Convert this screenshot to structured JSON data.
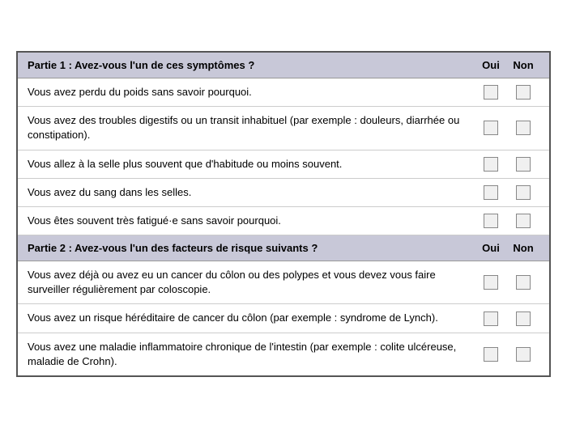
{
  "sections": [
    {
      "id": "partie1",
      "title": "Partie 1 : Avez-vous l'un de ces symptômes ?",
      "oui_label": "Oui",
      "non_label": "Non",
      "questions": [
        {
          "id": "q1",
          "text": "Vous avez perdu du poids sans savoir pourquoi."
        },
        {
          "id": "q2",
          "text": "Vous avez des troubles digestifs ou un transit inhabituel (par exemple : douleurs, diarrhée ou constipation)."
        },
        {
          "id": "q3",
          "text": "Vous allez à la selle plus souvent que d'habitude ou moins souvent."
        },
        {
          "id": "q4",
          "text": "Vous avez du sang dans les selles."
        },
        {
          "id": "q5",
          "text": "Vous êtes souvent très fatigué·e sans savoir pourquoi."
        }
      ]
    },
    {
      "id": "partie2",
      "title": "Partie 2 : Avez-vous l'un des facteurs de risque suivants ?",
      "oui_label": "Oui",
      "non_label": "Non",
      "questions": [
        {
          "id": "q6",
          "text": "Vous avez déjà ou avez eu un cancer du côlon ou des polypes et vous devez vous faire surveiller régulièrement par coloscopie."
        },
        {
          "id": "q7",
          "text": "Vous avez un risque héréditaire de cancer du côlon (par exemple : syndrome de Lynch)."
        },
        {
          "id": "q8",
          "text": "Vous avez une maladie inflammatoire chronique de l'intestin (par exemple : colite ulcéreuse, maladie de Crohn)."
        }
      ]
    }
  ]
}
